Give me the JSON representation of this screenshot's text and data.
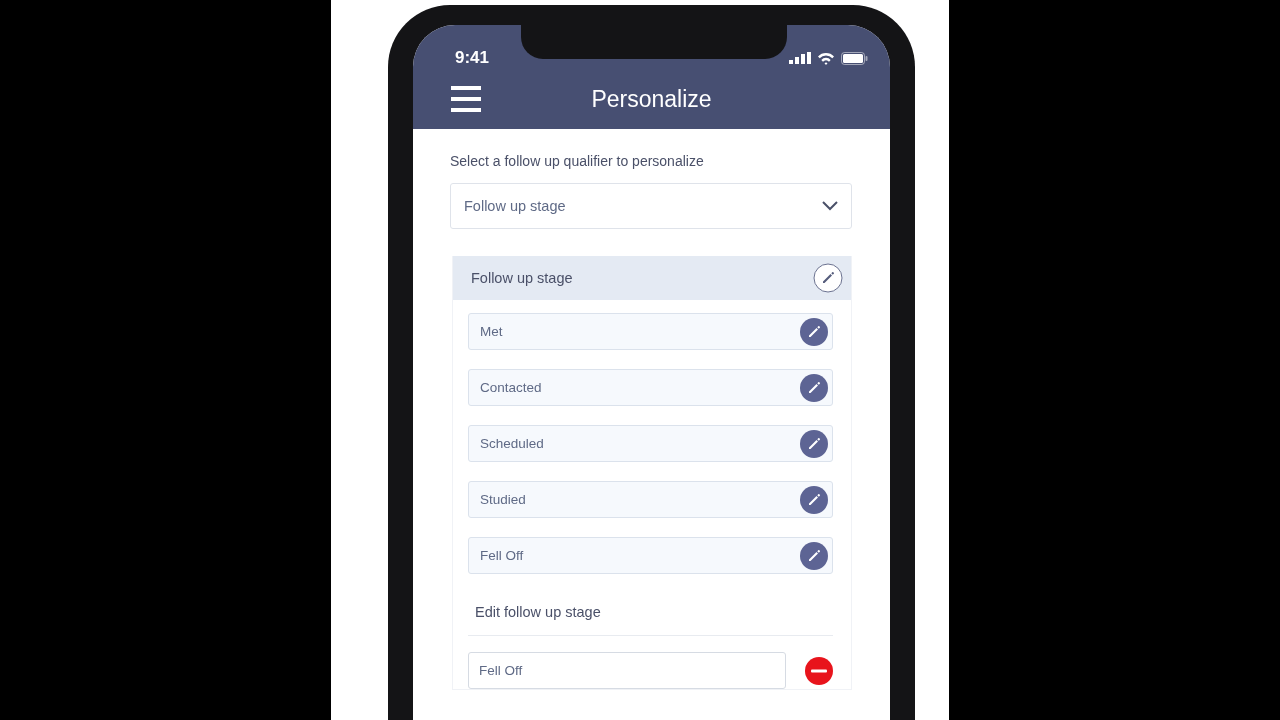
{
  "status_bar": {
    "time": "9:41"
  },
  "header": {
    "title": "Personalize"
  },
  "qualifier": {
    "label": "Select a follow up qualifier to personalize",
    "dropdown_value": "Follow up stage"
  },
  "stage_panel": {
    "title": "Follow up stage",
    "items": [
      {
        "label": "Met"
      },
      {
        "label": "Contacted"
      },
      {
        "label": "Scheduled"
      },
      {
        "label": "Studied"
      },
      {
        "label": "Fell Off"
      }
    ]
  },
  "edit_section": {
    "title": "Edit follow up stage",
    "field_value": "Fell Off"
  }
}
